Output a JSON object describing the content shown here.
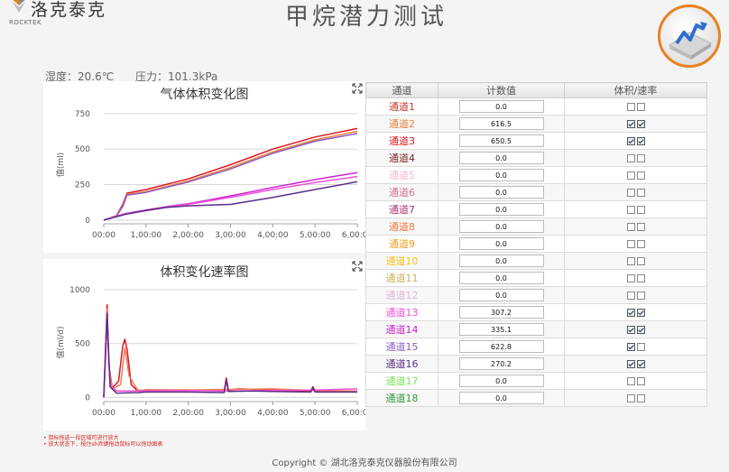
{
  "brand": {
    "name": "洛克泰克",
    "sub": "ROCKTEK"
  },
  "page_title": "甲烷潜力测试",
  "env": {
    "humidity": "湿度：20.6℃",
    "pressure": "压力：101.3kPa"
  },
  "table": {
    "headers": [
      "通道",
      "计数值",
      "体积/速率"
    ],
    "rows": [
      {
        "name": "通道1",
        "color": "#c0392b",
        "value": "0.0",
        "vol": false,
        "rate": false
      },
      {
        "name": "通道2",
        "color": "#e8823a",
        "value": "616.5",
        "vol": true,
        "rate": true
      },
      {
        "name": "通道3",
        "color": "#e0161b",
        "value": "650.5",
        "vol": true,
        "rate": true
      },
      {
        "name": "通道4",
        "color": "#7b2a2a",
        "value": "0.0",
        "vol": false,
        "rate": false
      },
      {
        "name": "通道5",
        "color": "#f7b6d2",
        "value": "0.0",
        "vol": false,
        "rate": false
      },
      {
        "name": "通道6",
        "color": "#d9708f",
        "value": "0.0",
        "vol": false,
        "rate": false
      },
      {
        "name": "通道7",
        "color": "#b0306e",
        "value": "0.0",
        "vol": false,
        "rate": false
      },
      {
        "name": "通道8",
        "color": "#f07a44",
        "value": "0.0",
        "vol": false,
        "rate": false
      },
      {
        "name": "通道9",
        "color": "#f0a020",
        "value": "0.0",
        "vol": false,
        "rate": false
      },
      {
        "name": "通道10",
        "color": "#f2c318",
        "value": "0.0",
        "vol": false,
        "rate": false
      },
      {
        "name": "通道11",
        "color": "#c8b25a",
        "value": "0.0",
        "vol": false,
        "rate": false
      },
      {
        "name": "通道12",
        "color": "#e0b8d0",
        "value": "0.0",
        "vol": false,
        "rate": false
      },
      {
        "name": "通道13",
        "color": "#f050d8",
        "value": "307.2",
        "vol": true,
        "rate": true
      },
      {
        "name": "通道14",
        "color": "#cc22cc",
        "value": "335.1",
        "vol": true,
        "rate": true
      },
      {
        "name": "通道15",
        "color": "#8a5cc8",
        "value": "622.8",
        "vol": true,
        "rate": false
      },
      {
        "name": "通道16",
        "color": "#5a2d8a",
        "value": "270.2",
        "vol": true,
        "rate": true
      },
      {
        "name": "通道17",
        "color": "#7be05a",
        "value": "0.0",
        "vol": false,
        "rate": false
      },
      {
        "name": "通道18",
        "color": "#2e9a3a",
        "value": "0.0",
        "vol": false,
        "rate": false
      }
    ]
  },
  "notes": [
    "鼠标拖选一段区域可进行放大",
    "放大状态下，按住shift键拖动鼠标可以拖动图表"
  ],
  "footer": "Copyright © 湖北洛克泰克仪器股份有限公司",
  "chart_data": [
    {
      "type": "line",
      "title": "气体体积变化图",
      "ylabel": "值(ml)",
      "x_ticks": [
        "00:00",
        "1,00:00",
        "2,00:00",
        "3,00:00",
        "4,00:00",
        "5,00:00",
        "6,00:00"
      ],
      "y_ticks": [
        0,
        250,
        500,
        750
      ],
      "xlim": [
        0,
        6
      ],
      "ylim": [
        -20,
        800
      ],
      "series": [
        {
          "name": "通道3",
          "color": "#e0161b",
          "x": [
            0,
            0.3,
            0.45,
            0.55,
            1,
            2,
            3,
            4,
            5,
            6
          ],
          "y": [
            0,
            30,
            110,
            190,
            215,
            290,
            390,
            500,
            585,
            645
          ]
        },
        {
          "name": "通道2",
          "color": "#e8823a",
          "x": [
            0,
            0.3,
            0.45,
            0.55,
            1,
            2,
            3,
            4,
            5,
            6
          ],
          "y": [
            0,
            28,
            100,
            180,
            200,
            275,
            370,
            480,
            565,
            625
          ]
        },
        {
          "name": "通道15",
          "color": "#8a5cc8",
          "x": [
            0,
            0.3,
            0.45,
            0.55,
            1,
            2,
            3,
            4,
            5,
            6
          ],
          "y": [
            0,
            25,
            95,
            175,
            195,
            268,
            360,
            470,
            555,
            610
          ]
        },
        {
          "name": "通道14",
          "color": "#cc22cc",
          "x": [
            0,
            0.5,
            1,
            1.5,
            2,
            3,
            4,
            5,
            6
          ],
          "y": [
            0,
            45,
            70,
            95,
            115,
            170,
            230,
            285,
            335
          ]
        },
        {
          "name": "通道13",
          "color": "#f050d8",
          "x": [
            0,
            0.5,
            1,
            1.5,
            2,
            3,
            4,
            5,
            6
          ],
          "y": [
            0,
            42,
            66,
            92,
            110,
            160,
            215,
            265,
            307
          ]
        },
        {
          "name": "通道16",
          "color": "#5a2d8a",
          "x": [
            0,
            0.5,
            1,
            1.5,
            2,
            2.5,
            3,
            4,
            5,
            6
          ],
          "y": [
            0,
            40,
            68,
            90,
            100,
            105,
            110,
            160,
            215,
            270
          ]
        }
      ]
    },
    {
      "type": "line",
      "title": "体积变化速率图",
      "ylabel": "值(ml/d)",
      "x_ticks": [
        "00:00",
        "1,00:00",
        "2,00:00",
        "3,00:00",
        "4,00:00",
        "5,00:00",
        "6,00:00"
      ],
      "y_ticks": [
        0,
        500,
        1000
      ],
      "xlim": [
        0,
        6
      ],
      "ylim": [
        -30,
        1050
      ],
      "series": [
        {
          "name": "通道3",
          "color": "#e0161b",
          "x": [
            0,
            0.08,
            0.12,
            0.2,
            0.35,
            0.45,
            0.5,
            0.55,
            0.65,
            0.8,
            1,
            2,
            2.85,
            2.9,
            2.95,
            3.2,
            4,
            4.9,
            4.95,
            5,
            6
          ],
          "y": [
            0,
            860,
            300,
            90,
            150,
            480,
            540,
            450,
            120,
            60,
            70,
            70,
            60,
            180,
            70,
            80,
            70,
            60,
            100,
            60,
            60
          ]
        },
        {
          "name": "通道2",
          "color": "#f07a60",
          "x": [
            0,
            0.08,
            0.12,
            0.2,
            0.4,
            0.5,
            0.6,
            0.8,
            1,
            2,
            3,
            4,
            5,
            6
          ],
          "y": [
            0,
            820,
            280,
            80,
            120,
            460,
            200,
            70,
            65,
            70,
            75,
            80,
            65,
            60
          ]
        },
        {
          "name": "通道13",
          "color": "#f050d8",
          "x": [
            0,
            0.08,
            0.15,
            0.3,
            1,
            2,
            3,
            4,
            5,
            6
          ],
          "y": [
            0,
            700,
            120,
            60,
            60,
            65,
            60,
            65,
            70,
            80
          ]
        },
        {
          "name": "通道16",
          "color": "#5a2d8a",
          "x": [
            0,
            0.08,
            0.15,
            0.3,
            0.8,
            1,
            2,
            2.85,
            2.9,
            2.95,
            3.5,
            4,
            4.9,
            4.95,
            5,
            6
          ],
          "y": [
            0,
            780,
            100,
            40,
            45,
            50,
            50,
            45,
            160,
            55,
            60,
            55,
            50,
            90,
            50,
            50
          ]
        }
      ]
    }
  ]
}
